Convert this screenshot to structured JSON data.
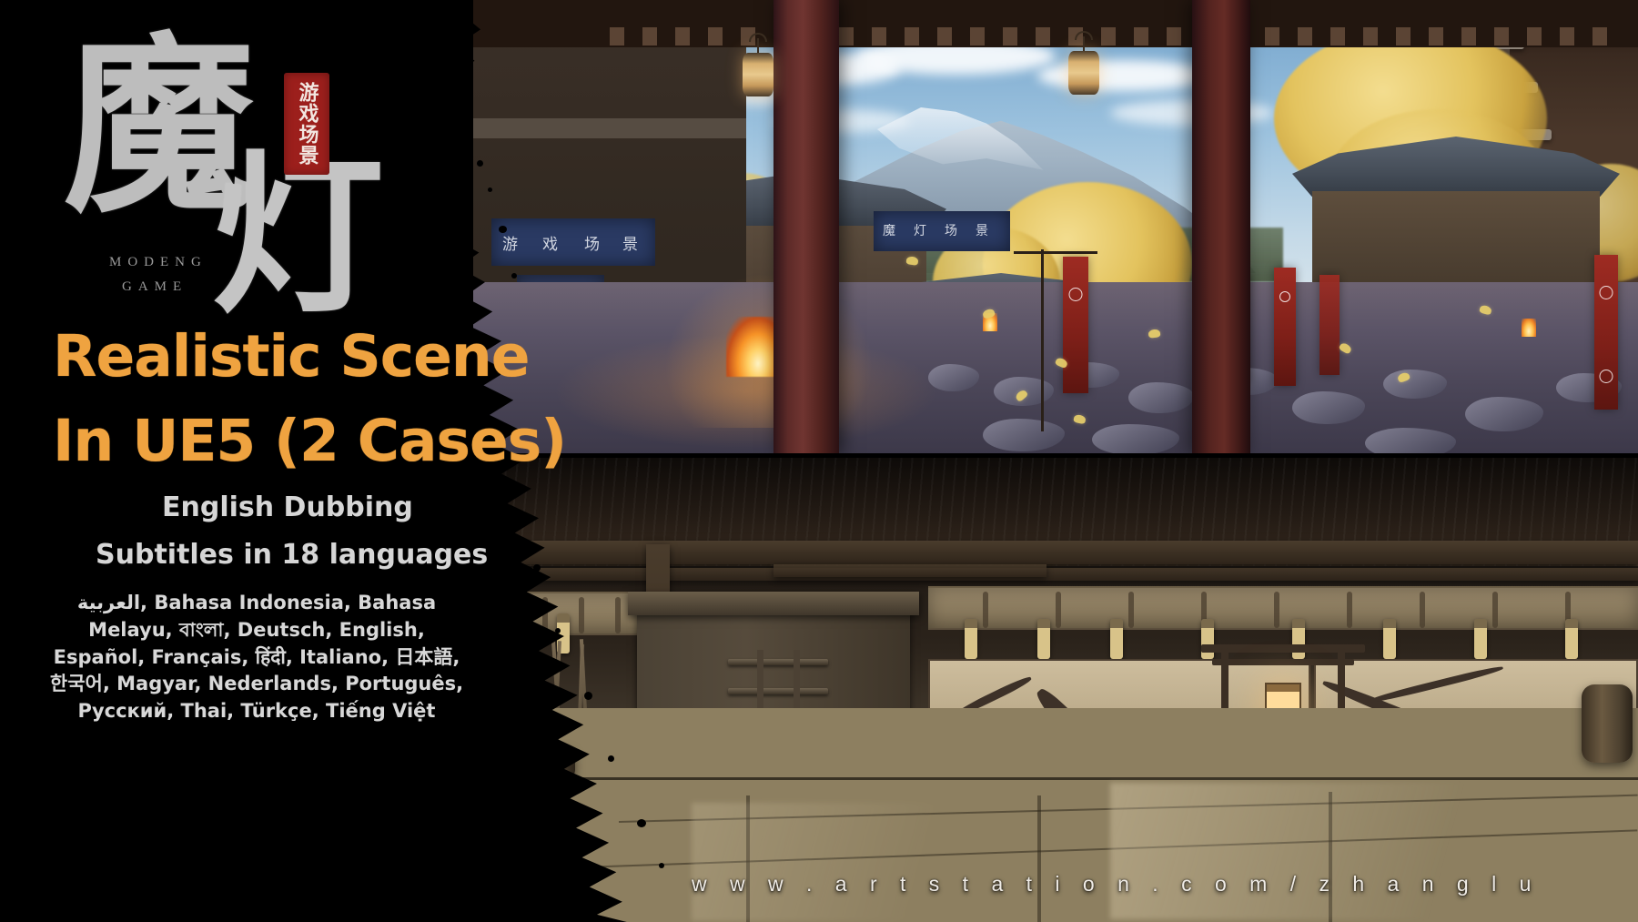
{
  "brand": {
    "logo_char_1": "魔",
    "logo_char_2": "灯",
    "seal_text": "游戏场景",
    "name_line_1": "MODENG",
    "name_line_2": "GAME",
    "seal_color": "#9c1f1c"
  },
  "headline": {
    "line_1": "Realistic Scene",
    "line_2": "In UE5 (2 Cases)",
    "color": "#efa340"
  },
  "subtitles": {
    "dubbing": "English Dubbing",
    "subtitle_count_line": "Subtitles in 18 languages",
    "color": "#d6d6d6"
  },
  "languages": {
    "text": "العربية, Bahasa Indonesia, Bahasa Melayu, বাংলা, Deutsch, English, Español, Français, हिंदी, Italiano, 日本語, 한국어, Magyar, Nederlands, Português, Русский, Thai, Türkçe, Tiếng Việt",
    "items": [
      "العربية",
      "Bahasa Indonesia",
      "Bahasa Melayu",
      "বাংলা",
      "Deutsch",
      "English",
      "Español",
      "Français",
      "हिंदी",
      "Italiano",
      "日本語",
      "한국어",
      "Magyar",
      "Nederlands",
      "Português",
      "Русский",
      "Thai",
      "Türkçe",
      "Tiếng Việt"
    ]
  },
  "url": {
    "text": "w w w . a r t s t a t i o n . c o m / z h a n g l u",
    "plain": "www.artstation.com/zhanglu"
  },
  "artwork": {
    "top_scene": {
      "name": "japanese-village-street",
      "shop_banner_text_1": "游戏场景",
      "shop_banner_text_2": "魔灯场景"
    },
    "bottom_scene": {
      "name": "japanese-dojo-interior"
    }
  }
}
